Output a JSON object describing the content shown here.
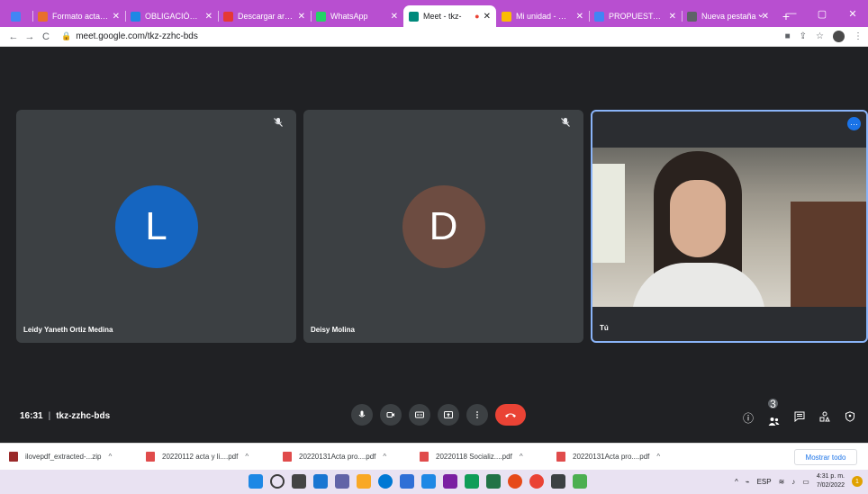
{
  "browser": {
    "tabs": [
      {
        "title": "",
        "favicon_color": "#4285f4",
        "active": false,
        "closable": false
      },
      {
        "title": "Formato acta de",
        "favicon_color": "#e86f2c",
        "active": false,
        "closable": true
      },
      {
        "title": "OBLIGACIÓN 1",
        "favicon_color": "#1e88e5",
        "active": false,
        "closable": true
      },
      {
        "title": "Descargar archiv",
        "favicon_color": "#e53935",
        "active": false,
        "closable": true
      },
      {
        "title": "WhatsApp",
        "favicon_color": "#25d366",
        "active": false,
        "closable": true
      },
      {
        "title": "Meet - tkz-",
        "favicon_color": "#00897b",
        "active": true,
        "closable": true
      },
      {
        "title": "Mi unidad - Goo",
        "favicon_color": "#fbbc04",
        "active": false,
        "closable": true
      },
      {
        "title": "PROPUESTA.doc",
        "favicon_color": "#4285f4",
        "active": false,
        "closable": true
      },
      {
        "title": "Nueva pestaña",
        "favicon_color": "#5f6368",
        "active": false,
        "closable": true
      }
    ],
    "new_tab_label": "+",
    "window_controls": [
      "⌄",
      "—",
      "▢",
      "✕"
    ],
    "back_icon": "←",
    "forward_icon": "→",
    "reload_icon": "C",
    "url": "meet.google.com/tkz-zzhc-bds"
  },
  "meet": {
    "participants": [
      {
        "name": "Leidy Yaneth Ortiz Medina",
        "initial": "L",
        "avatar_color": "#1565c0",
        "muted": true
      },
      {
        "name": "Deisy Molina",
        "initial": "D",
        "avatar_color": "#6d4c41",
        "muted": true
      },
      {
        "name": "Tú",
        "initial": "",
        "avatar_color": "",
        "muted": false
      }
    ],
    "time": "16:31",
    "separator": "|",
    "meeting_code": "tkz-zzhc-bds",
    "people_count": "3",
    "more_options_label": "···"
  },
  "downloads": {
    "items": [
      {
        "name": "ilovepdf_extracted-...zip",
        "type": "zip"
      },
      {
        "name": "20220112 acta y li....pdf",
        "type": "pdf"
      },
      {
        "name": "20220131Acta pro....pdf",
        "type": "pdf"
      },
      {
        "name": "20220118 Socializ....pdf",
        "type": "pdf"
      },
      {
        "name": "20220131Acta pro....pdf",
        "type": "pdf"
      }
    ],
    "show_all_label": "Mostrar todo"
  },
  "taskbar": {
    "language": "ESP",
    "time": "4:31 p. m.",
    "date": "7/02/2022",
    "notification_count": "1",
    "app_colors": [
      "#1e88e5",
      "#3c3c3c",
      "#444444",
      "#1976d2",
      "#0b57d0",
      "#f9a825",
      "#0078d4",
      "#2f6fd6",
      "#1e88e5",
      "#7b1fa2",
      "#0f9d58",
      "#217346",
      "#e64a19",
      "#ea4335",
      "#6264a7",
      "#4caf50"
    ]
  }
}
